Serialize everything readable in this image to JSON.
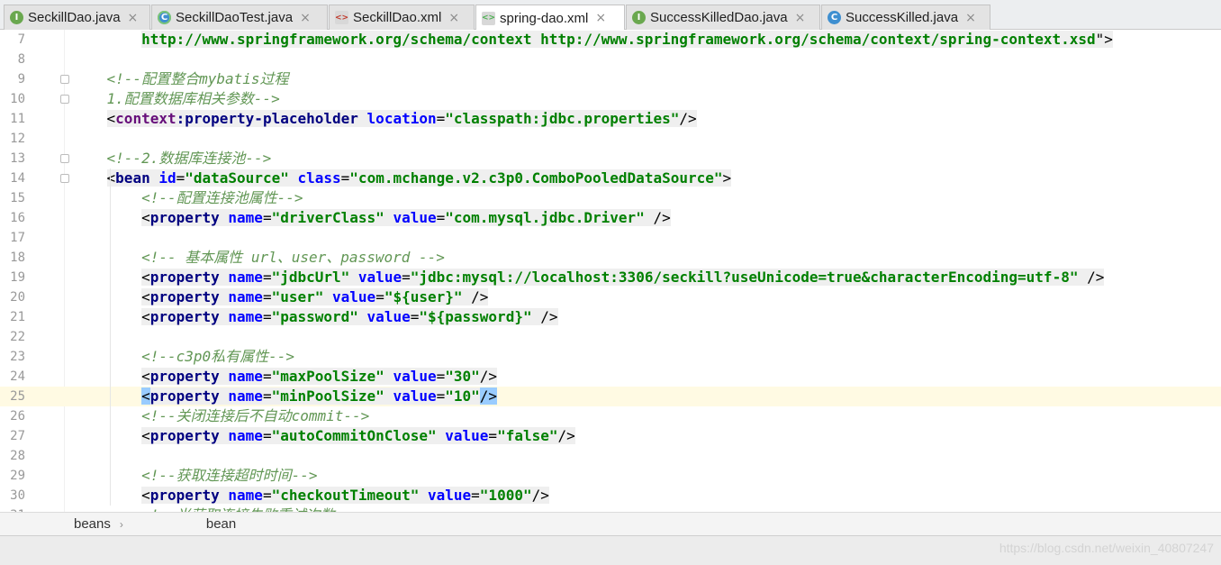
{
  "tabs": [
    {
      "label": "SeckillDao.java",
      "icon": "interface-icon",
      "glyph": "I",
      "active": false
    },
    {
      "label": "SeckillDaoTest.java",
      "icon": "test-class-icon",
      "glyph": "C",
      "active": false
    },
    {
      "label": "SeckillDao.xml",
      "icon": "xml-file-icon",
      "glyph": "<>",
      "active": false
    },
    {
      "label": "spring-dao.xml",
      "icon": "spring-xml-icon",
      "glyph": "<>",
      "active": true
    },
    {
      "label": "SuccessKilledDao.java",
      "icon": "interface-icon",
      "glyph": "I",
      "active": false
    },
    {
      "label": "SuccessKilled.java",
      "icon": "class-icon",
      "glyph": "C",
      "active": false
    }
  ],
  "close_glyph": "×",
  "editor": {
    "current_line": "25",
    "lines": [
      {
        "n": "7",
        "text": "        http://www.springframework.org/schema/context http://www.springframework.org/schema/context/spring-context.xsd\">"
      },
      {
        "n": "8",
        "text": ""
      },
      {
        "n": "9",
        "text": "    <!--配置整合mybatis过程"
      },
      {
        "n": "10",
        "text": "    1.配置数据库相关参数-->"
      },
      {
        "n": "11",
        "text": "    <context:property-placeholder location=\"classpath:jdbc.properties\"/>"
      },
      {
        "n": "12",
        "text": ""
      },
      {
        "n": "13",
        "text": "    <!--2.数据库连接池-->"
      },
      {
        "n": "14",
        "text": "    <bean id=\"dataSource\" class=\"com.mchange.v2.c3p0.ComboPooledDataSource\">"
      },
      {
        "n": "15",
        "text": "        <!--配置连接池属性-->"
      },
      {
        "n": "16",
        "text": "        <property name=\"driverClass\" value=\"com.mysql.jdbc.Driver\" />"
      },
      {
        "n": "17",
        "text": ""
      },
      {
        "n": "18",
        "text": "        <!-- 基本属性 url、user、password -->"
      },
      {
        "n": "19",
        "text": "        <property name=\"jdbcUrl\" value=\"jdbc:mysql://localhost:3306/seckill?useUnicode=true&characterEncoding=utf-8\" />"
      },
      {
        "n": "20",
        "text": "        <property name=\"user\" value=\"${user}\" />"
      },
      {
        "n": "21",
        "text": "        <property name=\"password\" value=\"${password}\" />"
      },
      {
        "n": "22",
        "text": ""
      },
      {
        "n": "23",
        "text": "        <!--c3p0私有属性-->"
      },
      {
        "n": "24",
        "text": "        <property name=\"maxPoolSize\" value=\"30\"/>"
      },
      {
        "n": "25",
        "text": "        <property name=\"minPoolSize\" value=\"10\"/>"
      },
      {
        "n": "26",
        "text": "        <!--关闭连接后不自动commit-->"
      },
      {
        "n": "27",
        "text": "        <property name=\"autoCommitOnClose\" value=\"false\"/>"
      },
      {
        "n": "28",
        "text": ""
      },
      {
        "n": "29",
        "text": "        <!--获取连接超时时间-->"
      },
      {
        "n": "30",
        "text": "        <property name=\"checkoutTimeout\" value=\"1000\"/>"
      },
      {
        "n": "31",
        "text": "        <!--当获取连接失败重试次数-->"
      }
    ]
  },
  "breadcrumb": {
    "items": [
      "beans",
      "bean"
    ],
    "separator": "›"
  },
  "status": {
    "watermark": "https://blog.csdn.net/weixin_40807247"
  },
  "colors": {
    "tag": "#000080",
    "attribute": "#0000ff",
    "value": "#008000",
    "comment": "#629755",
    "current_line": "#fffae3"
  }
}
